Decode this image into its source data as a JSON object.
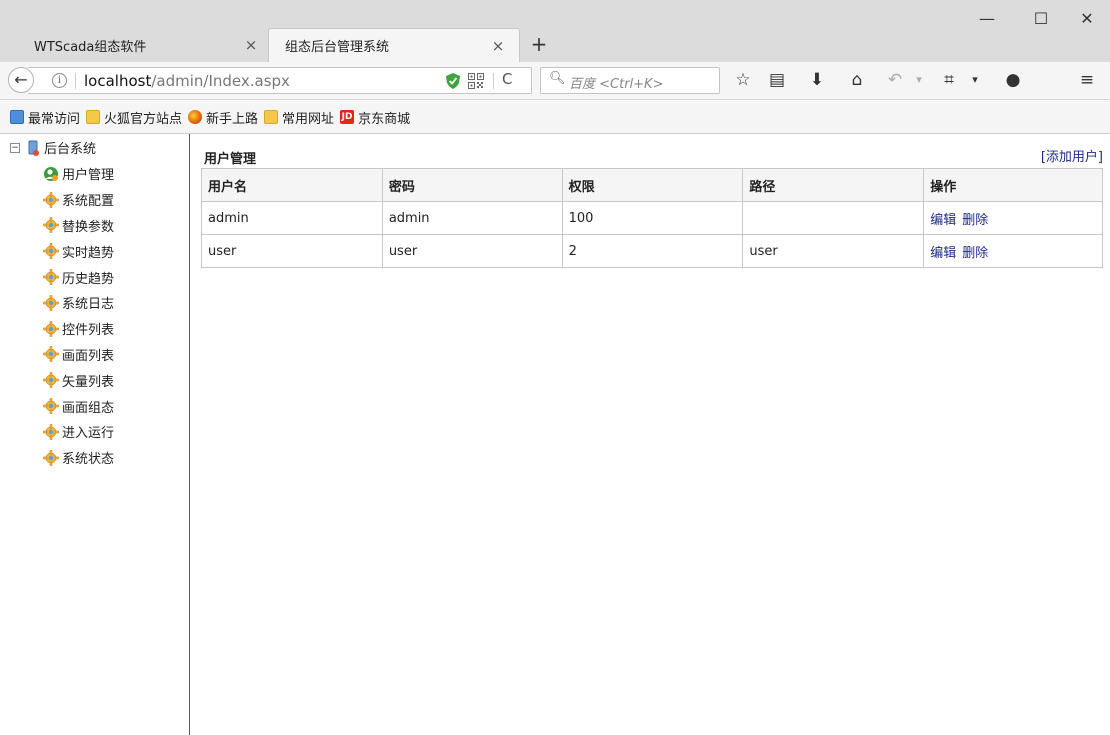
{
  "tabs": [
    {
      "title": "WTScada组态软件",
      "close": "×"
    },
    {
      "title": "组态后台管理系统",
      "close": "×"
    }
  ],
  "newtab": "+",
  "window_controls": {
    "minimize": "—",
    "maximize": "☐",
    "close": "✕"
  },
  "nav": {
    "back": "←",
    "url_host": "localhost",
    "url_path": "/admin/Index.aspx",
    "reload": "C",
    "search_placeholder": "百度 <Ctrl+K>"
  },
  "toolbar_icons": [
    "star-icon",
    "reading-list-icon",
    "download-icon",
    "home-icon",
    "undo-icon",
    "dropdown-icon",
    "crop-icon",
    "dropdown-icon",
    "chat-icon",
    "menu-icon"
  ],
  "bookmarks": [
    "最常访问",
    "火狐官方站点",
    "新手上路",
    "常用网址",
    "京东商城"
  ],
  "bookmark_jd_glyph": "JD",
  "tree": {
    "expander": "−",
    "root": "后台系统",
    "items": [
      "用户管理",
      "系统配置",
      "替换参数",
      "实时趋势",
      "历史趋势",
      "系统日志",
      "控件列表",
      "画面列表",
      "矢量列表",
      "画面组态",
      "进入运行",
      "系统状态"
    ]
  },
  "main": {
    "title": "用户管理",
    "add_link": "[添加用户]",
    "columns": [
      "用户名",
      "密码",
      "权限",
      "路径",
      "操作"
    ],
    "rows": [
      {
        "username": "admin",
        "password": "admin",
        "permission": "100",
        "path": "",
        "edit": "编辑",
        "delete": "删除"
      },
      {
        "username": "user",
        "password": "user",
        "permission": "2",
        "path": "user",
        "edit": "编辑",
        "delete": "删除"
      }
    ]
  },
  "colors": {
    "link": "#1f2a8a",
    "tabbar": "#dcdcdc",
    "toolbar": "#f5f5f5"
  }
}
